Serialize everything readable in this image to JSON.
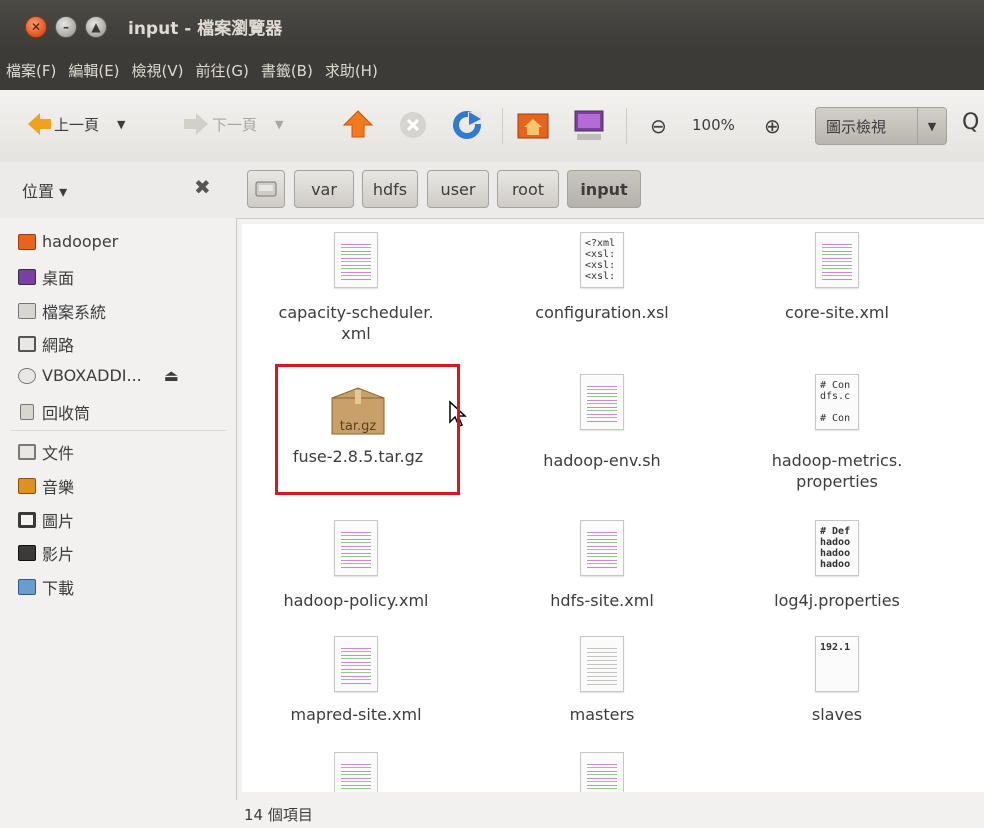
{
  "window": {
    "title": "input - 檔案瀏覽器"
  },
  "menu": [
    "檔案(F)",
    "編輯(E)",
    "檢視(V)",
    "前往(G)",
    "書籤(B)",
    "求助(H)"
  ],
  "toolbar": {
    "back_label": "上一頁",
    "forward_label": "下一頁",
    "zoom_value": "100%",
    "view_mode": "圖示檢視"
  },
  "sidebar": {
    "header": "位置 ▾",
    "items": [
      {
        "label": "hadooper",
        "icon": "home-folder-icon"
      },
      {
        "label": "桌面",
        "icon": "desktop-icon"
      },
      {
        "label": "檔案系統",
        "icon": "filesystem-icon"
      },
      {
        "label": "網路",
        "icon": "network-icon"
      },
      {
        "label": "VBOXADDI...",
        "icon": "cdrom-icon"
      },
      {
        "label": "回收筒",
        "icon": "trash-icon"
      },
      {
        "label": "文件",
        "icon": "documents-folder-icon"
      },
      {
        "label": "音樂",
        "icon": "music-folder-icon"
      },
      {
        "label": "圖片",
        "icon": "pictures-folder-icon"
      },
      {
        "label": "影片",
        "icon": "videos-folder-icon"
      },
      {
        "label": "下載",
        "icon": "downloads-folder-icon"
      }
    ]
  },
  "breadcrumbs": [
    "var",
    "hdfs",
    "user",
    "root",
    "input"
  ],
  "files": [
    {
      "name": "capacity-scheduler.\nxml",
      "thumb": "xml"
    },
    {
      "name": "configuration.xsl",
      "thumb": "<?xml\n<xsl:\n<xsl:\n<xsl:"
    },
    {
      "name": "core-site.xml",
      "thumb": "xml"
    },
    {
      "name": "fuse-2.8.5.tar.gz",
      "thumb": "tar.gz"
    },
    {
      "name": "hadoop-env.sh",
      "thumb": "xml"
    },
    {
      "name": "hadoop-metrics.\nproperties",
      "thumb": "# Con\ndfs.c\n\n# Con"
    },
    {
      "name": "hadoop-policy.xml",
      "thumb": "xml"
    },
    {
      "name": "hdfs-site.xml",
      "thumb": "xml"
    },
    {
      "name": "log4j.properties",
      "thumb": "# Def\nhadoo\nhadoo\nhadoo"
    },
    {
      "name": "mapred-site.xml",
      "thumb": "xml"
    },
    {
      "name": "masters",
      "thumb": "text"
    },
    {
      "name": "slaves",
      "thumb": "192.1"
    }
  ],
  "status": {
    "item_count": "14 個項目"
  },
  "colors": {
    "titlebar": "#3c3b37",
    "close_button": "#e0531c",
    "highlight_box": "#e0121b",
    "back_arrow": "#f0a11d"
  }
}
